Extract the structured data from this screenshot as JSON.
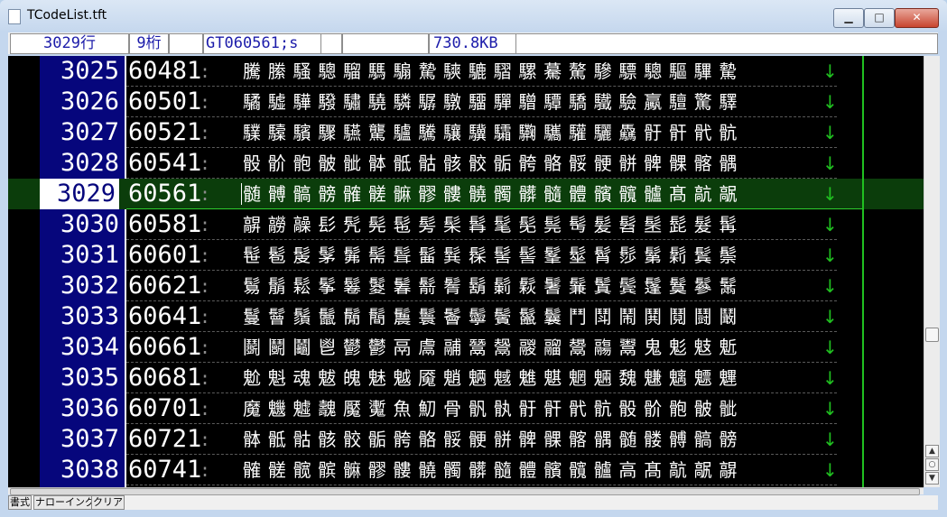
{
  "window": {
    "title": "TCodeList.tft"
  },
  "status": {
    "lines": "3029行",
    "column": "9桁",
    "code": "GT060561;s",
    "size": "730.8KB"
  },
  "rows": [
    {
      "ln": "3025",
      "code": "60481",
      "ctl": ":",
      "text": "騰 縢 騷 驄 騮 騳 騸 騺 騻 騼 騽 騾 驀 驁 驂 驃 驄 驅 驆 驇"
    },
    {
      "ln": "3026",
      "code": "60501",
      "ctl": ":",
      "text": "驈 驉 驊 驋 驌 驍 驎 驏 驐 驑 驒 驓 驔 驕 驖 驗 驘 驙 驚 驛"
    },
    {
      "ln": "3027",
      "code": "60521",
      "ctl": ":",
      "text": "驜 驝 驞 驟 驠 驡 驢 驣 驤 驥 驦 驧 驨 驩 驪 驫 骬 骭 骮 骯"
    },
    {
      "ln": "3028",
      "code": "60541",
      "ctl": ":",
      "text": "骰 骱 骲 骳 骴 骵 骶 骷 骸 骹 骺 骻 骼 骽 骾 骿 髀 髁 髂 髃"
    },
    {
      "ln": "3029",
      "code": "60561",
      "ctl": ":",
      "text": "髄 髆 髇 髈 髉 髊 髍 髎 髏 髐 髑 髒 髓 體 髕 髖 髗 髙 髚 髛"
    },
    {
      "ln": "3030",
      "code": "60581",
      "ctl": ":",
      "text": "髜 髝 髞 髟 髠 髡 髢 髣 髤 髥 髦 髧 髨 髩 髪 髫 髬 髭 髮 髯"
    },
    {
      "ln": "3031",
      "code": "60601",
      "ctl": ":",
      "text": "髰 髱 髲 髳 髴 髵 髶 髷 髸 髹 髺 髻 髼 髽 髾 髿 鬀 鬁 鬂 鬃"
    },
    {
      "ln": "3032",
      "code": "60621",
      "ctl": ":",
      "text": "鬄 鬅 鬆 鬇 鬈 鬉 鬊 鬋 鬌 鬍 鬎 鬏 鬐 鬑 鬒 鬓 鬔 鬕 鬖 鬗"
    },
    {
      "ln": "3033",
      "code": "60641",
      "ctl": ":",
      "text": "鬘 鬙 鬚 鬛 鬜 鬝 鬞 鬟 鬠 鬡 鬢 鬣 鬤 鬥 鬦 鬧 鬨 鬩 鬪 鬫"
    },
    {
      "ln": "3034",
      "code": "60661",
      "ctl": ":",
      "text": "鬬 鬭 鬮 鬯 鬰 鬱 鬲 鬳 鬴 鬵 鬶 鬷 鬸 鬹 鬺 鬻 鬼 鬽 鬾 鬿"
    },
    {
      "ln": "3035",
      "code": "60681",
      "ctl": ":",
      "text": "魀 魁 魂 魃 魄 魅 魆 魇 魈 魉 魊 魋 魌 魍 魎 魏 魐 魑 魒 魓"
    },
    {
      "ln": "3036",
      "code": "60701",
      "ctl": ":",
      "text": "魔 魕 魖 魗 魘 魙 魚 魛 骨 骪 骫 骬 骭 骮 骯 骰 骱 骲 骳 骴"
    },
    {
      "ln": "3037",
      "code": "60721",
      "ctl": ":",
      "text": "骵 骶 骷 骸 骹 骺 骻 骼 骽 骾 骿 髀 髁 髂 髃 髄 髅 髆 髇 髈"
    },
    {
      "ln": "3038",
      "code": "60741",
      "ctl": ":",
      "text": "髉 髊 髋 髌 髍 髎 髏 髐 髑 髒 髓 體 髕 髖 髗 高 髙 髚 髛 髜"
    }
  ],
  "current_row_index": 4,
  "eol_glyph": "↓",
  "bottom_tabs": [
    "書式",
    "ナローイング",
    "クリア"
  ],
  "colors": {
    "line_number_bg": "#06067c",
    "current_row_bg": "#0b3d0b",
    "eol_color": "#20c020",
    "status_text": "#1c1caa"
  }
}
